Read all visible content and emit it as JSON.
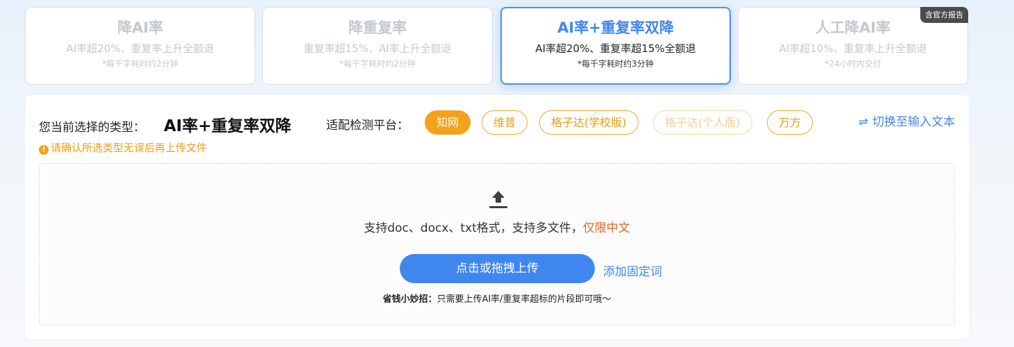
{
  "cards": [
    {
      "title": "降AI率",
      "desc": "AI率超20%、重复率上升全额退",
      "note": "*每千字耗时约2分钟"
    },
    {
      "title": "降重复率",
      "desc": "重复率超15%、AI率上升全额退",
      "note": "*每千字耗时约2分钟"
    },
    {
      "title": "AI率+重复率双降",
      "desc": "AI率超20%、重复率超15%全额退",
      "note": "*每千字耗时约3分钟"
    },
    {
      "title": "人工降AI率",
      "desc": "AI率超10%、重复率上升全额退",
      "note": "*24小时内交付",
      "badge": "含官方报告"
    }
  ],
  "panel": {
    "selected_label": "您当前选择的类型：",
    "selected_value": "AI率+重复率双降",
    "platform_label": "适配检测平台：",
    "platforms": [
      "知网",
      "维普",
      "格子达(学校版)",
      "格子达(个人版)",
      "万方"
    ],
    "switch_icon": "⇌",
    "switch_label": "切换至输入文本",
    "warning_icon": "!",
    "warning": "请确认所选类型无误后再上传文件"
  },
  "upload": {
    "formats_text": "支持doc、docx、txt格式，支持多文件，",
    "formats_highlight": "仅限中文",
    "button": "点击或拖拽上传",
    "fixed_words": "添加固定词",
    "tip_bold": "省钱小妙招：",
    "tip_text": "只需要上传AI率/重复率超标的片段即可哦～"
  },
  "icons": {
    "upload": "upload-icon",
    "switch": "swap-arrows-icon",
    "warning": "warning-icon"
  },
  "colors": {
    "accent": "#3f86ef",
    "orange": "#f3a21c",
    "highlight": "#e8641e"
  }
}
